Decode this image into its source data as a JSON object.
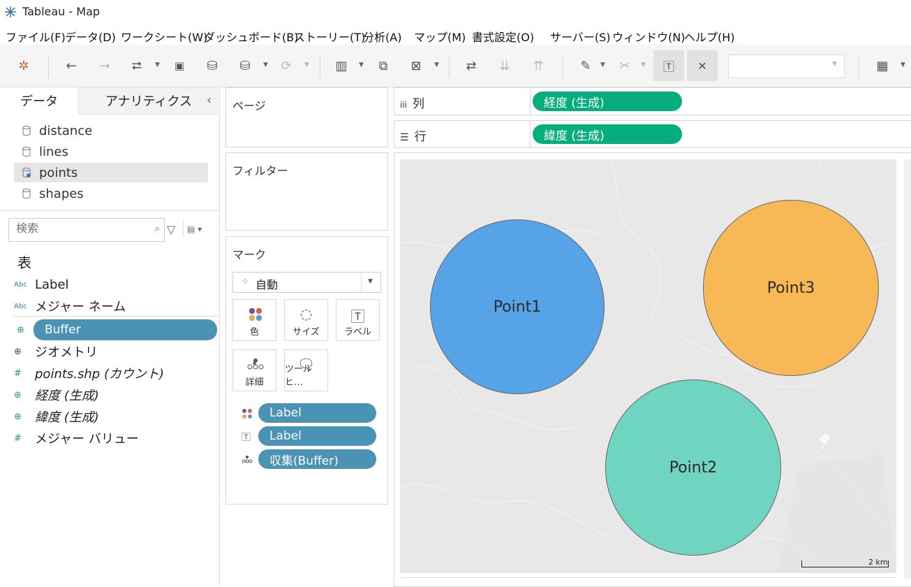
{
  "window": {
    "title": "Tableau - Map"
  },
  "menu": [
    "ファイル(F)",
    "データ(D)",
    "ワークシート(W)",
    "ダッシュボード(B)",
    "ストーリー(T)",
    "分析(A)",
    "マップ(M)",
    "書式設定(O)",
    "サーバー(S)",
    "ウィンドウ(N)",
    "ヘルプ(H)"
  ],
  "left_pane": {
    "tabs": [
      "データ",
      "アナリティクス"
    ],
    "collapse_glyph": "‹",
    "datasources": [
      {
        "name": "distance",
        "selected": false
      },
      {
        "name": "lines",
        "selected": false
      },
      {
        "name": "points",
        "selected": true
      },
      {
        "name": "shapes",
        "selected": false
      }
    ],
    "search_placeholder": "検索",
    "table_header": "表",
    "fields": [
      {
        "name": "Label",
        "type": "Abc",
        "italic": false
      },
      {
        "name": "メジャー ネーム",
        "type": "Abc",
        "italic": false
      },
      {
        "name": "Buffer",
        "type": "geo",
        "italic": false,
        "highlight": true
      },
      {
        "name": "ジオメトリ",
        "type": "geo-dark",
        "italic": false
      },
      {
        "name": "points.shp (カウント)",
        "type": "#",
        "italic": true
      },
      {
        "name": "経度 (生成)",
        "type": "geo",
        "italic": true
      },
      {
        "name": "緯度 (生成)",
        "type": "geo",
        "italic": true
      },
      {
        "name": "メジャー バリュー",
        "type": "#",
        "italic": false
      }
    ]
  },
  "shelves": {
    "pages_label": "ページ",
    "filters_label": "フィルター",
    "marks_label": "マーク",
    "mark_type": "自動",
    "mark_buttons": [
      "色",
      "サイズ",
      "ラベル",
      "詳細",
      "ツールヒ…"
    ],
    "mark_pills": [
      {
        "icon": "color-icon",
        "label": "Label"
      },
      {
        "icon": "label-icon",
        "label": "Label"
      },
      {
        "icon": "detail-icon",
        "label": "収集(Buffer)"
      }
    ],
    "columns_label": "列",
    "rows_label": "行",
    "columns_pill": "経度 (生成)",
    "rows_pill": "緯度 (生成)"
  },
  "map": {
    "points": [
      {
        "label": "Point1",
        "color": "#57a3e8"
      },
      {
        "label": "Point3",
        "color": "#f8b856"
      },
      {
        "label": "Point2",
        "color": "#6fd5c1"
      }
    ],
    "scale_label": "2 km"
  },
  "colors": {
    "pill_blue": "#4a93b4",
    "pill_green": "#05ae7c",
    "map_bg": "#e8e8e8"
  }
}
